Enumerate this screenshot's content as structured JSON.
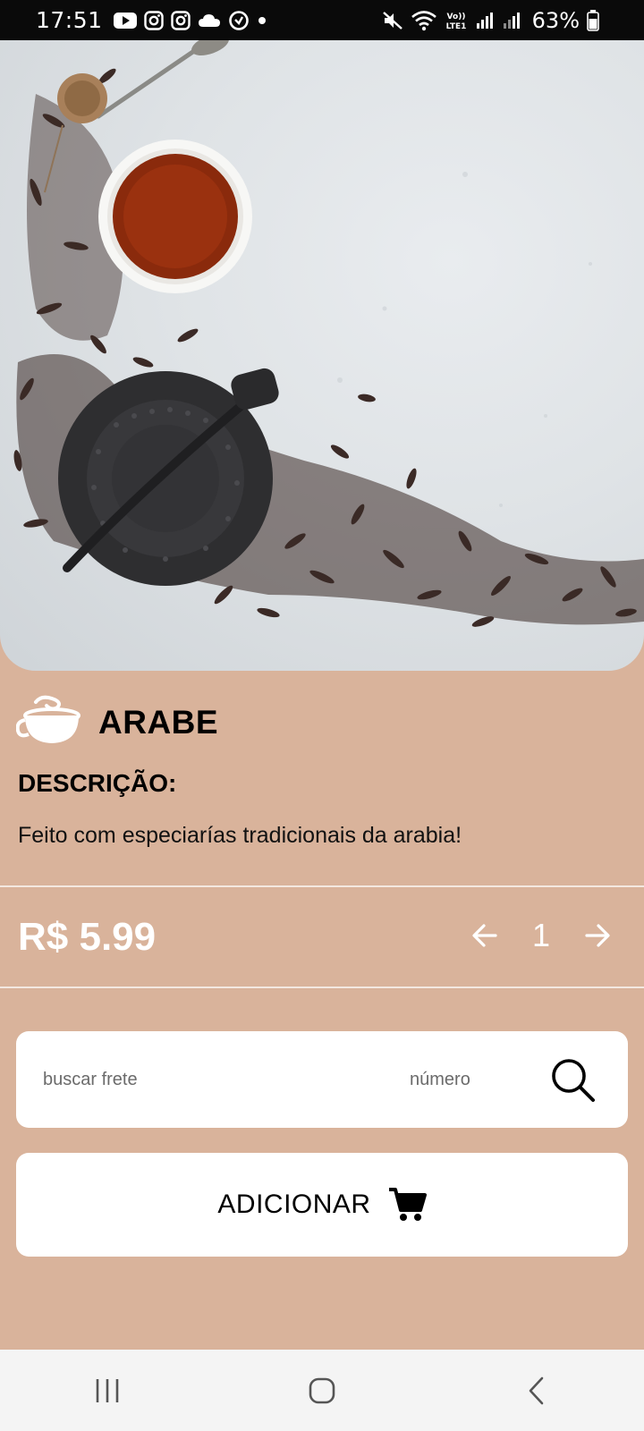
{
  "status_bar": {
    "time": "17:51",
    "battery": "63%",
    "left_icons": [
      "youtube-icon",
      "instagram-icon",
      "instagram-icon",
      "cloud-icon",
      "activity-icon",
      "dot-icon"
    ],
    "right_icons": [
      "mute-icon",
      "wifi-icon",
      "volte-icon",
      "signal-icon",
      "signal-icon",
      "battery-icon"
    ]
  },
  "product": {
    "name": "ARABE",
    "description_title": "DESCRIÇÃO:",
    "description": "Feito com especiarías tradicionais da arabia!",
    "price": "R$ 5.99",
    "quantity": "1"
  },
  "freight": {
    "cep_placeholder": "buscar frete",
    "number_placeholder": "número"
  },
  "actions": {
    "add_label": "ADICIONAR"
  },
  "colors": {
    "background": "#d9b39b",
    "card": "#ffffff",
    "status_bar": "#0a0a0a",
    "nav_bar": "#f4f4f4"
  }
}
